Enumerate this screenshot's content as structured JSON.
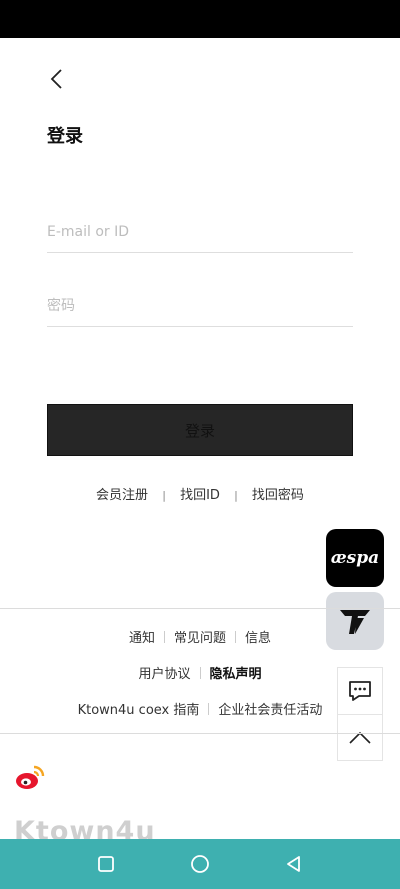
{
  "header": {
    "title": "登录"
  },
  "form": {
    "email_placeholder": "E-mail or ID",
    "password_placeholder": "密码",
    "login_label": "登录"
  },
  "links": {
    "signup": "会员注册",
    "find_id": "找回ID",
    "find_password": "找回密码",
    "separator": "|"
  },
  "footer": {
    "row1": [
      "通知",
      "常见问题",
      "信息"
    ],
    "row2": [
      "用户协议",
      "隐私声明"
    ],
    "row3": [
      "Ktown4u coex 指南",
      "企业社会责任活动"
    ]
  },
  "floating": {
    "aespa_label": "æspa"
  },
  "brand": {
    "logo_text": "Ktown4u"
  },
  "colors": {
    "nav_bar": "#3eb0b0",
    "button_bg": "#262626",
    "status_bar": "#000000"
  },
  "icons": [
    "back-icon",
    "weibo-icon",
    "chat-icon",
    "chevron-up-icon",
    "square-icon",
    "circle-icon",
    "triangle-back-icon"
  ]
}
